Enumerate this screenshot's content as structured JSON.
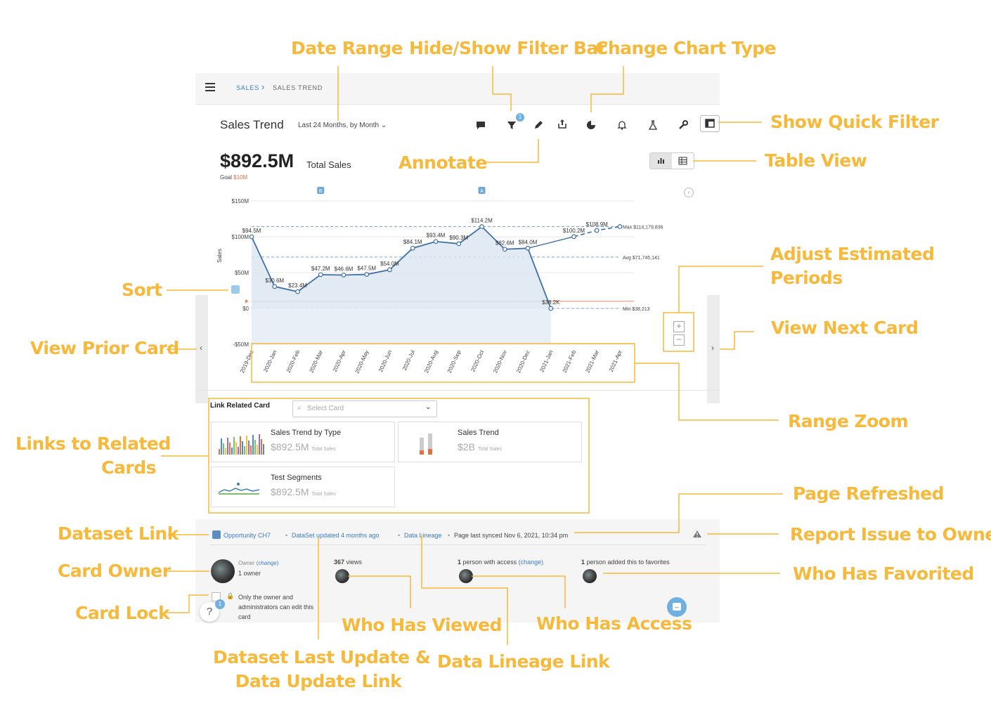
{
  "breadcrumb": {
    "level1": "SALES",
    "separator": "›",
    "level2": "SALES TREND"
  },
  "card": {
    "title": "Sales Trend",
    "date_range": "Last 24 Months, by Month",
    "filter_count": "1",
    "kpi_value": "$892.5M",
    "kpi_label": "Total Sales",
    "goal_label": "Goal",
    "goal_value": "$10M"
  },
  "toolbar_icons": [
    "comment-icon",
    "filter-icon",
    "pencil-icon",
    "share-icon",
    "pie-chart-icon",
    "bell-icon",
    "flask-icon",
    "wrench-icon",
    "quick-filter-icon"
  ],
  "chart_data": {
    "type": "line",
    "ylabel": "Sales",
    "yticks": [
      "$150M",
      "$100M",
      "$50M",
      "$0",
      "-$50M"
    ],
    "ylim": [
      -50,
      150
    ],
    "categories": [
      "2019-Dec",
      "2020-Jan",
      "2020-Feb",
      "2020-Mar",
      "2020-Apr",
      "2020-May",
      "2020-Jun",
      "2020-Jul",
      "2020-Aug",
      "2020-Sep",
      "2020-Oct",
      "2020-Nov",
      "2020-Dec",
      "2021-Jan",
      "2021-Feb",
      "2021-Mar",
      "2021-Apr"
    ],
    "series": [
      {
        "values": [
          100.0,
          30.6,
          23.4,
          47.2,
          46.6,
          47.5,
          54.0,
          84.1,
          93.4,
          90.3,
          114.2,
          82.6,
          84.0,
          0.038,
          100.2,
          108.9,
          114.2
        ]
      }
    ],
    "data_labels": [
      "$94.5M",
      "$30.6M",
      "$23.4M",
      "$47.2M",
      "$46.6M",
      "$47.5M",
      "$54.0M",
      "$84.1M",
      "$93.4M",
      "$90.3M",
      "$114.2M",
      "$82.6M",
      "$84.0M",
      "$38.2K",
      "$100.2M",
      "$108.9M",
      ""
    ],
    "estimated_from_index": 13,
    "reference_lines": [
      {
        "label": "Max $114,179,836",
        "value": 114.18
      },
      {
        "label": "Avg $71,745,141",
        "value": 71.75
      },
      {
        "label": "Min $38,213",
        "value": 0.038
      }
    ],
    "goal_line": 10,
    "annotation_markers": [
      {
        "label": "B",
        "at": "2020-Mar"
      },
      {
        "label": "A",
        "at": "2020-Oct"
      }
    ],
    "grid": true
  },
  "related": {
    "label": "Link Related Card",
    "select_placeholder": "Select Card",
    "cards": [
      {
        "title": "Sales Trend by Type",
        "value": "$892.5M",
        "unit": "Total Sales"
      },
      {
        "title": "Sales Trend",
        "value": "$2B",
        "unit": "Total Sales"
      },
      {
        "title": "Test Segments",
        "value": "$892.5M",
        "unit": "Total Sales"
      }
    ]
  },
  "footer": {
    "dataset": "Opportunity CH7",
    "dataset_updated": "DataSet updated 4 months ago",
    "data_lineage": "Data Lineage",
    "page_synced": "Page last synced Nov 6, 2021, 10:34 pm",
    "owner_label": "Owner",
    "owner_change": "(change)",
    "owner_count": "1 owner",
    "lock_text": "Only the owner and administrators can edit this card",
    "views_count": "367",
    "views_label": "views",
    "access_prefix": "1",
    "access_text": "person with access",
    "access_change": "(change)",
    "fav_prefix": "1",
    "fav_text": "person added this to favorites",
    "help_badge": "1"
  },
  "callouts": {
    "date_range": "Date Range",
    "filter_bar": "Hide/Show Filter Bar",
    "chart_type": "Change Chart Type",
    "quick_filter": "Show Quick Filter",
    "annotate": "Annotate",
    "table_view": "Table View",
    "adjust_1": "Adjust Estimated",
    "adjust_2": "Periods",
    "sort": "Sort",
    "view_prior": "View Prior Card",
    "view_next": "View Next Card",
    "range_zoom": "Range Zoom",
    "related_1": "Links to Related",
    "related_2": "Cards",
    "page_refreshed": "Page Refreshed",
    "dataset_link": "Dataset Link",
    "report_issue": "Report Issue to Owner",
    "card_owner": "Card Owner",
    "who_fav": "Who Has Favorited",
    "card_lock": "Card Lock",
    "who_viewed": "Who Has Viewed",
    "who_access": "Who Has Access",
    "dataset_update_1": "Dataset Last Update &",
    "dataset_update_2": "Data Update Link",
    "lineage_link": "Data Lineage Link"
  }
}
